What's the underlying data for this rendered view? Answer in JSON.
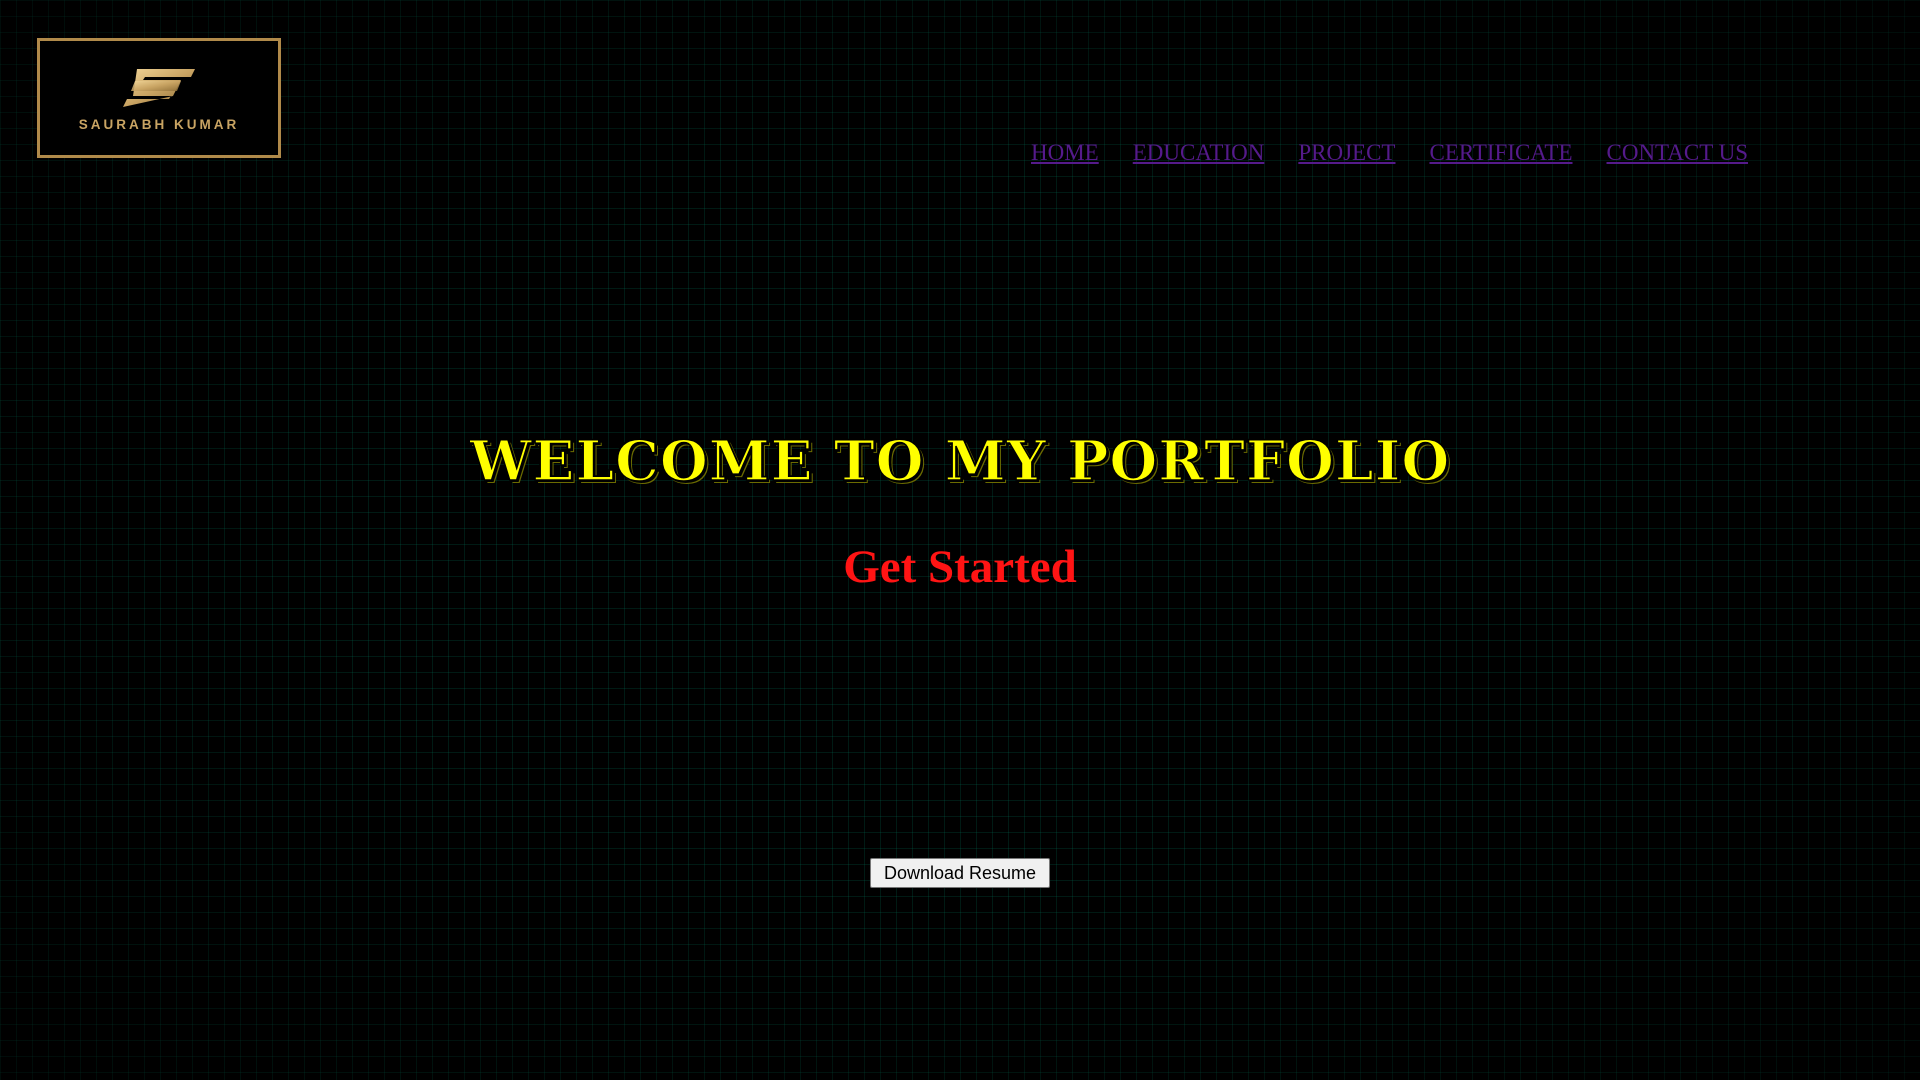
{
  "logo": {
    "name": "SAURABH KUMAR",
    "border_color": "#b08a4a",
    "icon": "s-monogram-icon"
  },
  "nav": {
    "items": [
      {
        "label": "HOME"
      },
      {
        "label": "EDUCATION"
      },
      {
        "label": "PROJECT"
      },
      {
        "label": "CERTIFICATE"
      },
      {
        "label": "CONTACT US"
      }
    ],
    "link_color": "#551a8b"
  },
  "hero": {
    "title": "WELCOME TO MY PORTFOLIO",
    "title_color": "#ffff00",
    "subtitle": "Get Started",
    "subtitle_color": "#ff1414"
  },
  "actions": {
    "download_label": "Download Resume"
  }
}
